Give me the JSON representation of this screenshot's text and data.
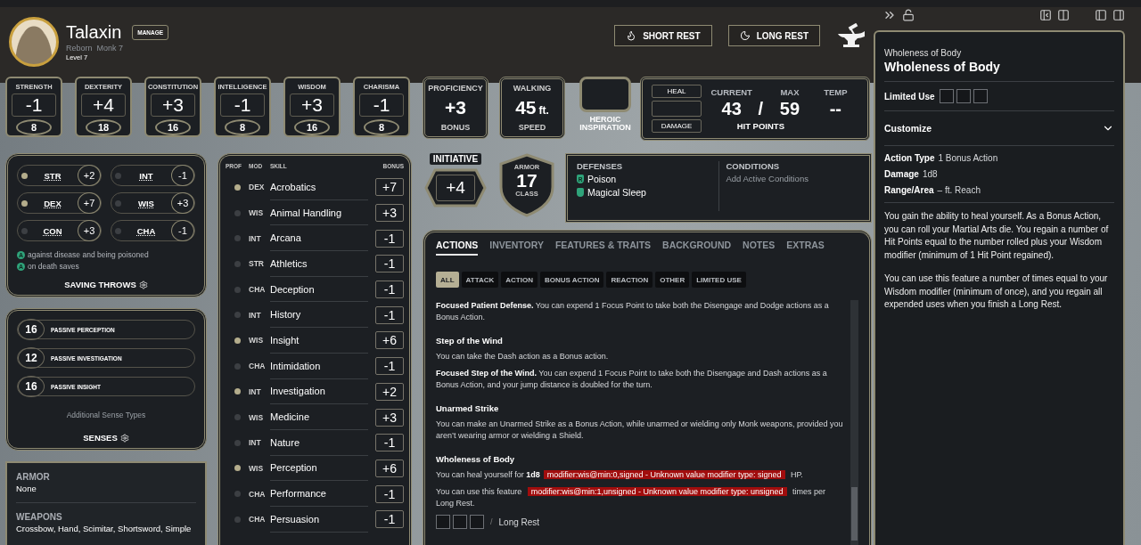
{
  "character": {
    "name": "Talaxin",
    "manage": "MANAGE",
    "species": "Reborn",
    "class": "Monk 7",
    "level": "Level 7"
  },
  "rest_buttons": [
    {
      "kind": "short",
      "label": "SHORT REST"
    },
    {
      "kind": "long",
      "label": "LONG REST"
    }
  ],
  "abilities": [
    {
      "name": "STRENGTH",
      "modifier": "-1",
      "score": "8"
    },
    {
      "name": "DEXTERITY",
      "modifier": "+4",
      "score": "18"
    },
    {
      "name": "CONSTITUTION",
      "modifier": "+3",
      "score": "16"
    },
    {
      "name": "INTELLIGENCE",
      "modifier": "-1",
      "score": "8"
    },
    {
      "name": "WISDOM",
      "modifier": "+3",
      "score": "16"
    },
    {
      "name": "CHARISMA",
      "modifier": "-1",
      "score": "8"
    }
  ],
  "proficiency": {
    "label": "PROFICIENCY",
    "value": "+3",
    "caption": "BONUS"
  },
  "speed": {
    "label": "WALKING",
    "value": "45",
    "unit": "ft.",
    "caption": "SPEED"
  },
  "heroic_inspiration": {
    "label": "HEROIC INSPIRATION",
    "on": false
  },
  "hit_points": {
    "heal": "HEAL",
    "damage": "DAMAGE",
    "current_label": "CURRENT",
    "max_label": "MAX",
    "temp_label": "TEMP",
    "current": "43",
    "separator": "/",
    "max": "59",
    "temp": "--",
    "caption": "HIT POINTS"
  },
  "saving_throws": {
    "items": [
      {
        "ability": "STR",
        "bonus": "+2",
        "proficient": true
      },
      {
        "ability": "INT",
        "bonus": "-1",
        "proficient": false
      },
      {
        "ability": "DEX",
        "bonus": "+7",
        "proficient": true
      },
      {
        "ability": "WIS",
        "bonus": "+3",
        "proficient": false
      },
      {
        "ability": "CON",
        "bonus": "+3",
        "proficient": false
      },
      {
        "ability": "CHA",
        "bonus": "-1",
        "proficient": false
      }
    ],
    "notes": [
      {
        "badge": "A",
        "text": "against disease and being poisoned"
      },
      {
        "badge": "A",
        "text": "on death saves"
      }
    ],
    "title": "SAVING THROWS"
  },
  "senses": {
    "items": [
      {
        "value": "16",
        "label": "PASSIVE PERCEPTION"
      },
      {
        "value": "12",
        "label": "PASSIVE INVESTIGATION"
      },
      {
        "value": "16",
        "label": "PASSIVE INSIGHT"
      }
    ],
    "additional": "Additional Sense Types",
    "title": "SENSES"
  },
  "proficiencies": [
    {
      "heading": "ARMOR",
      "value": "None"
    },
    {
      "heading": "WEAPONS",
      "value": "Crossbow, Hand, Scimitar, Shortsword, Simple"
    }
  ],
  "skills": {
    "headers": [
      "PROF",
      "MOD",
      "SKILL",
      "BONUS"
    ],
    "rows": [
      {
        "proficient": true,
        "mod": "DEX",
        "name": "Acrobatics",
        "bonus": "+7"
      },
      {
        "proficient": false,
        "mod": "WIS",
        "name": "Animal Handling",
        "bonus": "+3"
      },
      {
        "proficient": false,
        "mod": "INT",
        "name": "Arcana",
        "bonus": "-1"
      },
      {
        "proficient": false,
        "mod": "STR",
        "name": "Athletics",
        "bonus": "-1"
      },
      {
        "proficient": false,
        "mod": "CHA",
        "name": "Deception",
        "bonus": "-1"
      },
      {
        "proficient": false,
        "mod": "INT",
        "name": "History",
        "bonus": "-1"
      },
      {
        "proficient": true,
        "mod": "WIS",
        "name": "Insight",
        "bonus": "+6"
      },
      {
        "proficient": false,
        "mod": "CHA",
        "name": "Intimidation",
        "bonus": "-1"
      },
      {
        "proficient": true,
        "mod": "INT",
        "name": "Investigation",
        "bonus": "+2"
      },
      {
        "proficient": false,
        "mod": "WIS",
        "name": "Medicine",
        "bonus": "+3"
      },
      {
        "proficient": false,
        "mod": "INT",
        "name": "Nature",
        "bonus": "-1"
      },
      {
        "proficient": true,
        "mod": "WIS",
        "name": "Perception",
        "bonus": "+6"
      },
      {
        "proficient": false,
        "mod": "CHA",
        "name": "Performance",
        "bonus": "-1"
      },
      {
        "proficient": false,
        "mod": "CHA",
        "name": "Persuasion",
        "bonus": "-1"
      }
    ]
  },
  "initiative": {
    "label": "INITIATIVE",
    "value": "+4"
  },
  "armor_class": {
    "top": "ARMOR",
    "value": "17",
    "bottom": "CLASS"
  },
  "defenses": {
    "title": "DEFENSES",
    "items": [
      {
        "kind": "resistance",
        "badge": "R",
        "label": "Poison"
      },
      {
        "kind": "immunity",
        "label": "Magical Sleep"
      }
    ]
  },
  "conditions": {
    "title": "CONDITIONS",
    "add": "Add Active Conditions"
  },
  "tabs": [
    {
      "label": "ACTIONS",
      "selected": true
    },
    {
      "label": "INVENTORY",
      "selected": false
    },
    {
      "label": "FEATURES & TRAITS",
      "selected": false
    },
    {
      "label": "BACKGROUND",
      "selected": false
    },
    {
      "label": "NOTES",
      "selected": false
    },
    {
      "label": "EXTRAS",
      "selected": false
    }
  ],
  "filters": [
    {
      "label": "ALL",
      "selected": true
    },
    {
      "label": "ATTACK",
      "selected": false
    },
    {
      "label": "ACTION",
      "selected": false
    },
    {
      "label": "BONUS ACTION",
      "selected": false
    },
    {
      "label": "REACTION",
      "selected": false
    },
    {
      "label": "OTHER",
      "selected": false
    },
    {
      "label": "LIMITED USE",
      "selected": false
    }
  ],
  "actions": [
    {
      "paragraphs": [
        [
          {
            "kind": "bold",
            "text": "Focused Patient Defense."
          },
          {
            "kind": "text",
            "text": " You can expend 1 Focus Point to take both the Disengage and Dodge actions as a Bonus Action."
          }
        ]
      ]
    },
    {
      "heading": "Step of the Wind",
      "paragraphs": [
        [
          {
            "kind": "text",
            "text": "You can take the Dash action as a Bonus action."
          }
        ],
        [
          {
            "kind": "bold",
            "text": "Focused Step of the Wind."
          },
          {
            "kind": "text",
            "text": " You can expend 1 Focus Point to take both the Disengage and Dash actions as a Bonus Action, and your jump distance is doubled for the turn."
          }
        ]
      ]
    },
    {
      "heading": "Unarmed Strike",
      "paragraphs": [
        [
          {
            "kind": "text",
            "text": "You can make an Unarmed Strike as a Bonus Action, while unarmed or wielding only Monk weapons, provided you aren’t wearing armor or wielding a Shield."
          }
        ]
      ]
    },
    {
      "heading": "Wholeness of Body",
      "paragraphs": [
        [
          {
            "kind": "text",
            "text": "You can heal yourself for "
          },
          {
            "kind": "bold",
            "text": "1d8"
          },
          {
            "kind": "error",
            "text": "modifier:wis@min:0,signed - Unknown value modifier type: signed"
          },
          {
            "kind": "text",
            "text": " HP."
          }
        ],
        [
          {
            "kind": "text",
            "text": "You can use this feature "
          },
          {
            "kind": "error",
            "text": "modifier:wis@min:1,unsigned - Unknown value modifier type: unsigned"
          },
          {
            "kind": "text",
            "text": " times per Long Rest."
          }
        ]
      ],
      "uses": {
        "slots": [
          {
            "checked": false
          },
          {
            "checked": false
          },
          {
            "checked": false
          }
        ],
        "separator": "/",
        "label": "Long Rest"
      }
    }
  ],
  "detail": {
    "breadcrumb": "Wholeness of Body",
    "title": "Wholeness of Body",
    "limited_use": {
      "label": "Limited Use",
      "slots": [
        {
          "checked": false
        },
        {
          "checked": false
        },
        {
          "checked": false
        }
      ]
    },
    "customize": {
      "label": "Customize",
      "expanded": false
    },
    "properties": [
      {
        "label": "Action Type",
        "value": "1 Bonus Action"
      },
      {
        "label": "Damage",
        "value": "1d8"
      },
      {
        "label": "Range/Area",
        "value": "– ft. Reach"
      }
    ],
    "description": [
      "You gain the ability to heal yourself. As a Bonus Action, you can roll your Martial Arts die. You regain a number of Hit Points equal to the number rolled plus your Wisdom modifier (minimum of 1 Hit Point regained).",
      "You can use this feature a number of times equal to your Wisdom modifier (minimum of once), and you regain all expended uses when you finish a Long Rest."
    ]
  }
}
